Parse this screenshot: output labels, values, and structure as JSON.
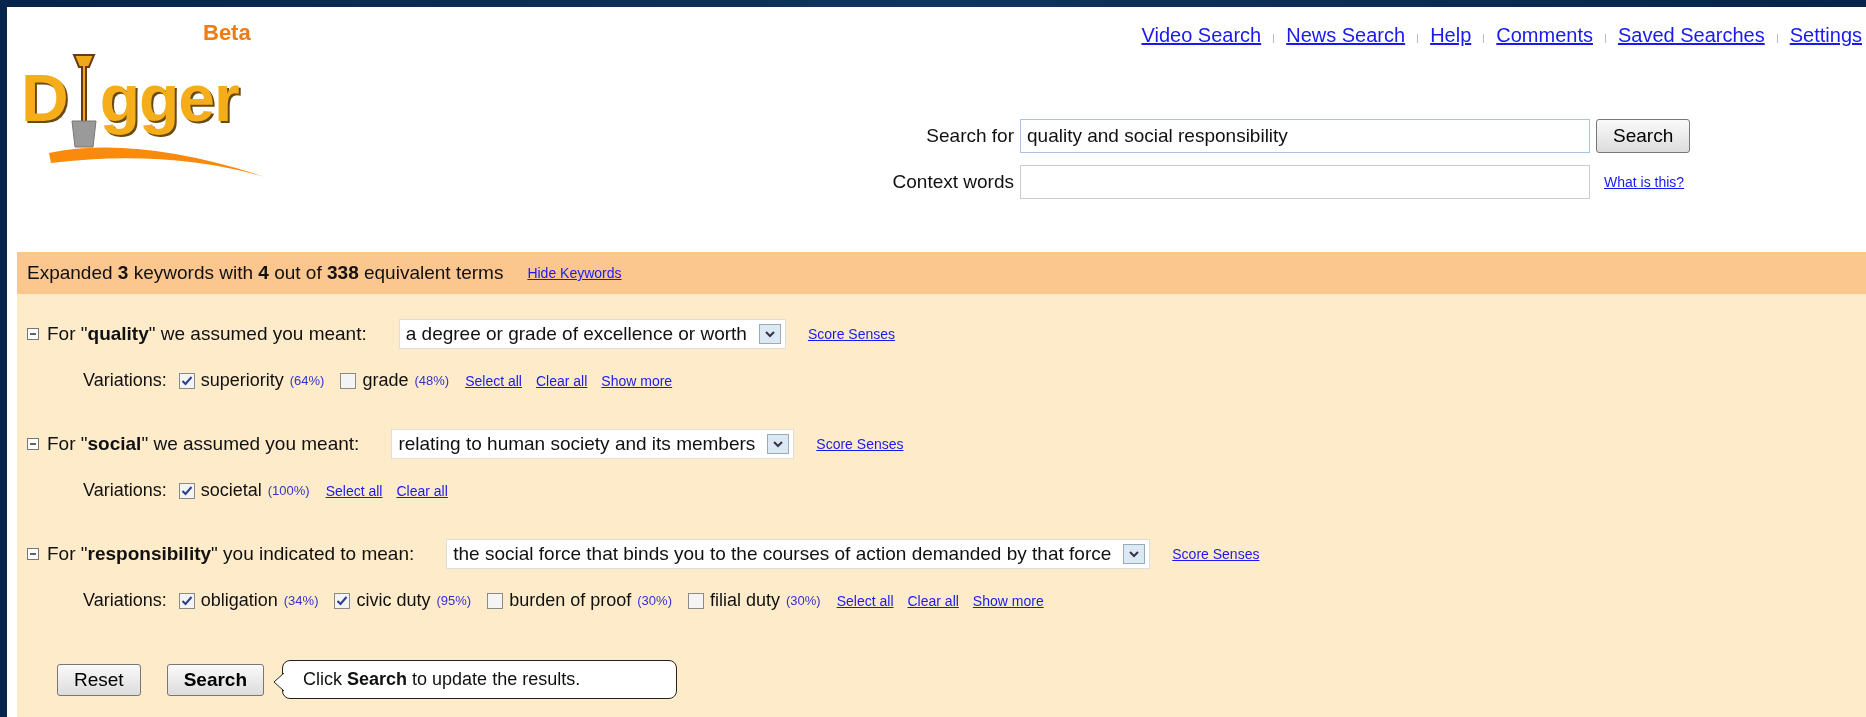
{
  "logo": {
    "letters_before": "D",
    "letters_after": "gger",
    "badge": "Beta"
  },
  "nav_links": [
    "Video Search",
    "News Search",
    "Help",
    "Comments",
    "Saved Searches",
    "Settings"
  ],
  "search": {
    "label": "Search for",
    "value": "quality and social responsibility",
    "button": "Search"
  },
  "context": {
    "label": "Context words",
    "link": "What is this?"
  },
  "keywords_bar": {
    "summary": "Expanded **3** keywords with **4** out of **338** equivalent terms",
    "link": "Hide Keywords"
  },
  "keywords": [
    {
      "expanded": true,
      "text": "For \"**quality**\" we assumed you meant:",
      "sense": "a degree or grade of excellence or worth",
      "score_link": "Score Senses",
      "variations_label": "Variations:",
      "variations": [
        {
          "term": "superiority",
          "score": "(64%)",
          "checked": true
        },
        {
          "term": "grade",
          "score": "(48%)",
          "checked": false
        }
      ],
      "links": [
        "Select all",
        "Clear all",
        "Show more"
      ]
    },
    {
      "expanded": true,
      "text": "For \"**social**\" we assumed you meant:",
      "sense": "relating to human society and its members",
      "score_link": "Score Senses",
      "variations_label": "Variations:",
      "variations": [
        {
          "term": "societal",
          "score": "(100%)",
          "checked": true
        }
      ],
      "links": [
        "Select all",
        "Clear all"
      ]
    },
    {
      "expanded": true,
      "text": "For \"**responsibility**\" you indicated to mean:",
      "sense": "the social force that binds you to the courses of action demanded by that force",
      "score_link": "Score Senses",
      "variations_label": "Variations:",
      "variations": [
        {
          "term": "obligation",
          "score": "(34%)",
          "checked": true
        },
        {
          "term": "civic duty",
          "score": "(95%)",
          "checked": true
        },
        {
          "term": "burden of proof",
          "score": "(30%)",
          "checked": false
        },
        {
          "term": "filial duty",
          "score": "(30%)",
          "checked": false
        }
      ],
      "links": [
        "Select all",
        "Clear all",
        "Show more"
      ]
    }
  ],
  "actions": {
    "reset": "Reset",
    "search": "Search",
    "tip": "Click **Search** to update the results."
  }
}
